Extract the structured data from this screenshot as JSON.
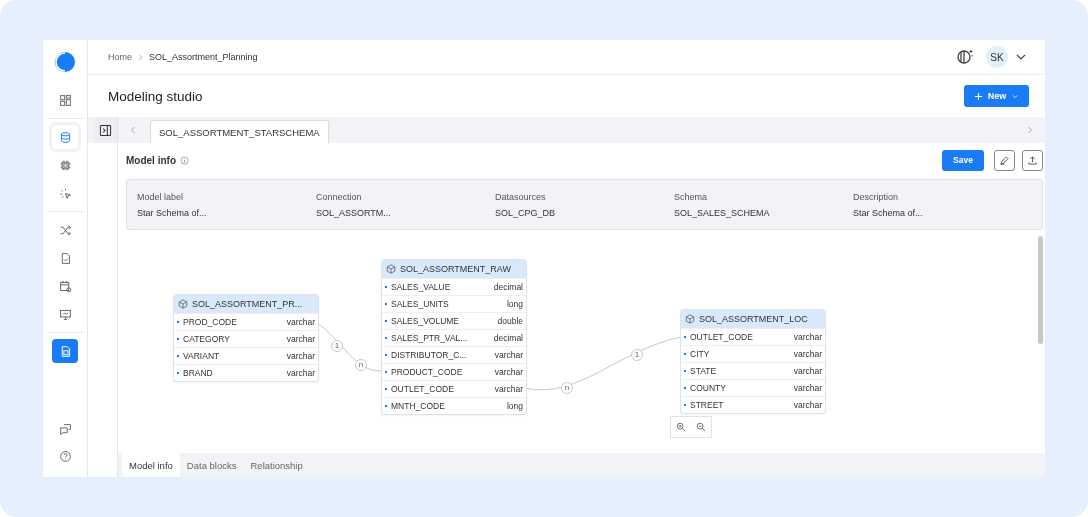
{
  "sidebar": {
    "items": [
      {
        "selected": false,
        "highlighted": false
      },
      {
        "selected": false,
        "highlighted": true
      },
      {
        "selected": false,
        "highlighted": false
      },
      {
        "selected": false,
        "highlighted": false
      },
      {
        "selected": false,
        "highlighted": false
      },
      {
        "selected": false,
        "highlighted": false
      },
      {
        "selected": false,
        "highlighted": false
      },
      {
        "selected": false,
        "highlighted": false
      },
      {
        "selected": true,
        "highlighted": false
      }
    ]
  },
  "breadcrumb": [
    "Home",
    "SOL_Assortment_Planning"
  ],
  "user": {
    "initials": "SK"
  },
  "page_title": "Modeling studio",
  "new_button": "New",
  "tabs": [
    {
      "label": "SOL_ASSORTMENT_STARSCHEMA",
      "selected": true
    }
  ],
  "model_info": {
    "title": "Model info",
    "save_button": "Save",
    "fields": [
      {
        "label": "Model label",
        "value": "Star Schema of..."
      },
      {
        "label": "Connection",
        "value": "SOL_ASSORTM..."
      },
      {
        "label": "Datasources",
        "value": "SOL_CPG_DB"
      },
      {
        "label": "Schema",
        "value": "SOL_SALES_SCHEMA"
      },
      {
        "label": "Description",
        "value": "Star Schema of..."
      }
    ]
  },
  "diagram": {
    "tables": [
      {
        "name": "SOL_ASSORTMENT_PR...",
        "columns": [
          {
            "name": "PROD_CODE",
            "type": "varchar"
          },
          {
            "name": "CATEGORY",
            "type": "varchar"
          },
          {
            "name": "VARIANT",
            "type": "varchar"
          },
          {
            "name": "BRAND",
            "type": "varchar"
          }
        ]
      },
      {
        "name": "SOL_ASSORTMENT_RAW",
        "columns": [
          {
            "name": "SALES_VALUE",
            "type": "decimal"
          },
          {
            "name": "SALES_UNITS",
            "type": "long"
          },
          {
            "name": "SALES_VOLUME",
            "type": "double"
          },
          {
            "name": "SALES_PTR_VAL...",
            "type": "decimal"
          },
          {
            "name": "DISTRIBUTOR_C...",
            "type": "varchar"
          },
          {
            "name": "PRODUCT_CODE",
            "type": "varchar"
          },
          {
            "name": "OUTLET_CODE",
            "type": "varchar"
          },
          {
            "name": "MNTH_CODE",
            "type": "long"
          }
        ]
      },
      {
        "name": "SOL_ASSORTMENT_LOC",
        "columns": [
          {
            "name": "OUTLET_CODE",
            "type": "varchar"
          },
          {
            "name": "CITY",
            "type": "varchar"
          },
          {
            "name": "STATE",
            "type": "varchar"
          },
          {
            "name": "COUNTY",
            "type": "varchar"
          },
          {
            "name": "STREET",
            "type": "varchar"
          }
        ]
      }
    ],
    "relations": [
      {
        "from_label": "1",
        "to_label": "n"
      },
      {
        "from_label": "n",
        "to_label": "1"
      }
    ]
  },
  "bottom_tabs": [
    {
      "label": "Model info",
      "selected": true
    },
    {
      "label": "Data blocks",
      "selected": false
    },
    {
      "label": "Relationship",
      "selected": false
    }
  ]
}
